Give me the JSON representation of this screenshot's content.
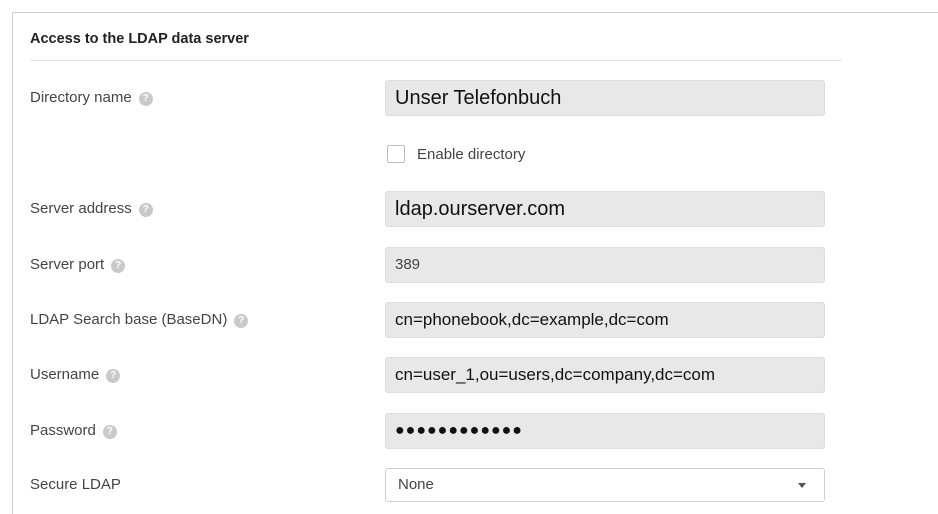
{
  "section": {
    "title": "Access to the LDAP data server"
  },
  "fields": {
    "directory_name": {
      "label": "Directory name",
      "value": "Unser Telefonbuch"
    },
    "enable_directory": {
      "label": "Enable directory",
      "checked": false
    },
    "server_address": {
      "label": "Server address",
      "value": "ldap.ourserver.com"
    },
    "server_port": {
      "label": "Server port",
      "value": "389"
    },
    "search_base": {
      "label": "LDAP Search base (BaseDN)",
      "value": "cn=phonebook,dc=example,dc=com"
    },
    "username": {
      "label": "Username",
      "value": "cn=user_1,ou=users,dc=company,dc=com"
    },
    "password": {
      "label": "Password",
      "value": "●●●●●●●●●●●●"
    },
    "secure_ldap": {
      "label": "Secure LDAP",
      "selected": "None"
    }
  },
  "icons": {
    "help": "help-question-circle-icon",
    "dropdown": "caret-down-icon"
  },
  "colors": {
    "field_bg": "#e8e8e8",
    "help_icon": "#c9c9c9"
  }
}
